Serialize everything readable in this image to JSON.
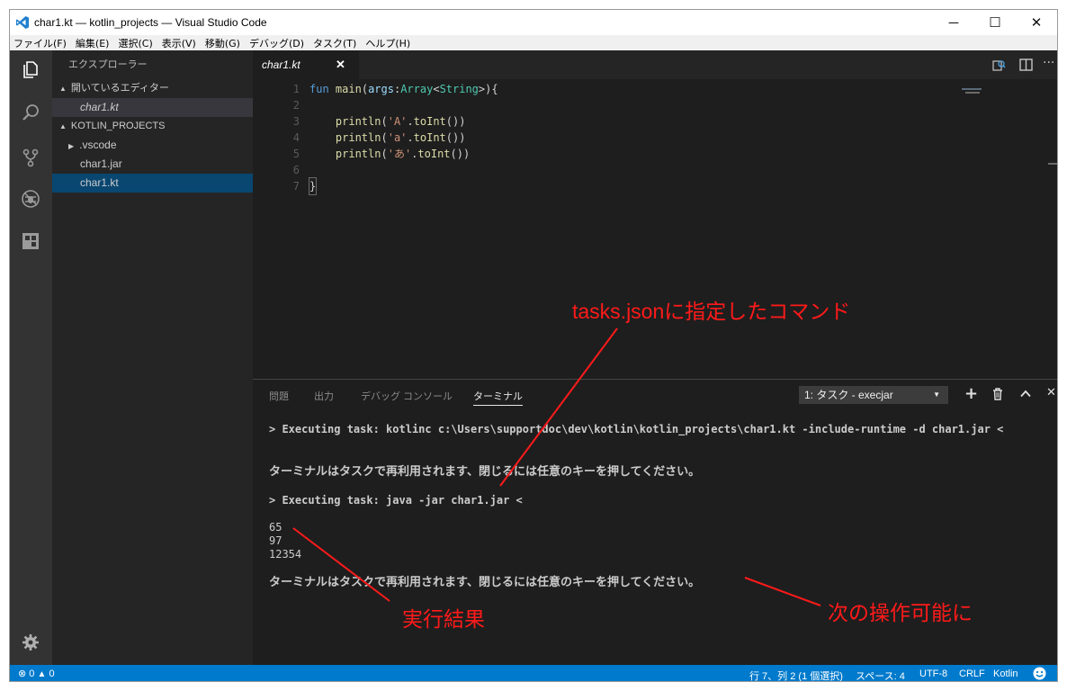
{
  "window": {
    "title": "char1.kt — kotlin_projects — Visual Studio Code"
  },
  "menu": [
    "ファイル(F)",
    "編集(E)",
    "選択(C)",
    "表示(V)",
    "移動(G)",
    "デバッグ(D)",
    "タスク(T)",
    "ヘルプ(H)"
  ],
  "sidebar": {
    "title": "エクスプローラー",
    "open_editors_label": "開いているエディター",
    "open_editors": [
      "char1.kt"
    ],
    "project_label": "KOTLIN_PROJECTS",
    "files": [
      ".vscode",
      "char1.jar",
      "char1.kt"
    ]
  },
  "editor": {
    "tab_label": "char1.kt",
    "line_numbers": [
      "1",
      "2",
      "3",
      "4",
      "5",
      "6",
      "7"
    ]
  },
  "panel": {
    "tabs": [
      "問題",
      "出力",
      "デバッグ コンソール",
      "ターミナル"
    ],
    "terminal_select": "1: タスク - execjar",
    "terminal_lines": [
      "> Executing task: kotlinc c:\\Users\\supportdoc\\dev\\kotlin\\kotlin_projects\\char1.kt -include-runtime -d char1.jar <",
      "ターミナルはタスクで再利用されます、閉じるには任意のキーを押してください。",
      "> Executing task: java -jar char1.jar <",
      "65",
      "97",
      "12354",
      "ターミナルはタスクで再利用されます、閉じるには任意のキーを押してください。"
    ]
  },
  "status": {
    "errors": "0",
    "warnings": "0",
    "position": "行 7、列 2 (1 個選択)",
    "spaces": "スペース: 4",
    "encoding": "UTF-8",
    "eol": "CRLF",
    "language": "Kotlin"
  },
  "annotations": {
    "command": "tasks.jsonに指定したコマンド",
    "result": "実行結果",
    "next": "次の操作可能に"
  },
  "colors": {
    "accent": "#007acc",
    "annotation": "#ff1a1a"
  }
}
